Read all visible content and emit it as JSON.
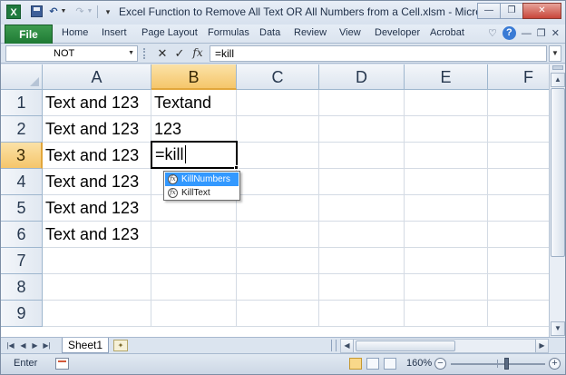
{
  "title_bar": {
    "app_icon": "excel-icon",
    "title": "Excel Function to Remove All Text OR All Numbers from a Cell.xlsm - Micros...",
    "qat": [
      "save-icon",
      "undo-icon",
      "redo-icon",
      "customize-qat-icon"
    ]
  },
  "ribbon": {
    "file_tab": "File",
    "tabs": [
      "Home",
      "Insert",
      "Page Layout",
      "Formulas",
      "Data",
      "Review",
      "View",
      "Developer",
      "Acrobat"
    ],
    "help_label": "?"
  },
  "formula_bar": {
    "name_box": "NOT",
    "cancel_symbol": "✕",
    "enter_symbol": "✓",
    "fx_label": "fx",
    "formula": "=kill"
  },
  "grid": {
    "columns": [
      "A",
      "B",
      "C",
      "D",
      "E",
      "F"
    ],
    "selected_column": "B",
    "rows": [
      "1",
      "2",
      "3",
      "4",
      "5",
      "6",
      "7",
      "8",
      "9"
    ],
    "selected_row": "3",
    "cells": {
      "A1": "Text and 123",
      "B1": "Textand",
      "A2": "Text and 123",
      "B2": "123",
      "A3": "Text and 123",
      "A4": "Text and 123",
      "A5": "Text and 123",
      "A6": "Text and 123"
    },
    "active_cell": {
      "ref": "B3",
      "editing_text": "=kill"
    }
  },
  "autocomplete": {
    "items": [
      "KillNumbers",
      "KillText"
    ],
    "selected_index": 0,
    "item_icon": "function-icon"
  },
  "sheets": {
    "tabs": [
      "Sheet1"
    ],
    "active": "Sheet1"
  },
  "status_bar": {
    "mode": "Enter",
    "zoom": "160%",
    "zoom_fraction": 0.6
  },
  "colors": {
    "file_tab": "#1f7a34",
    "selected_header": "#f5c66b",
    "autocomplete_highlight": "#3399ff"
  }
}
